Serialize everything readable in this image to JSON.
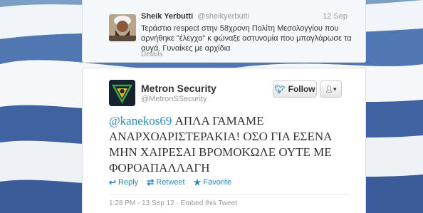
{
  "reply_tweet": {
    "name": "Sheik Yerbutti",
    "handle": "@sheikyerbutti",
    "time": "12 Sep",
    "text": "Τεράστιο respect στην 58χρονη Πολίτη Μεσολογγίου που αρνήθηκε \"έλεγχο\" κ φώναξε αστυνομία που μπαγλάρωσε τα αυγά. Γυναίκες με αρχίδια",
    "details_label": "Details"
  },
  "main_tweet": {
    "name": "Metron Security",
    "handle": "@MetronSSecurity",
    "follow_label": "Follow",
    "mention": "@kanekos69",
    "text": " ΑΠΛΑ ΓΑΜΑΜΕ ΑΝΑΡΧΟΑΡΙΣΤΕΡΑΚΙΑ! ΟΣΟ ΓΙΑ ΕΣΕΝΑ ΜΗΝ ΧΑΙΡΕΣΑΙ ΒΡΟΜΟΚΩΛΕ ΟΥΤΕ ΜΕ ΦΟΡΟΑΠΑΛΛΑΓΗ",
    "actions": {
      "reply": "Reply",
      "retweet": "Retweet",
      "favorite": "Favorite"
    },
    "meta": "1:28 PM - 13 Sep 12 · Embed this Tweet"
  },
  "colors": {
    "link": "#2a8ab8",
    "flag_blue": "#4a6fa8",
    "flag_white": "#ffffff"
  },
  "icons": {
    "follow": "bird-icon",
    "user_menu": "user-dropdown-icon",
    "reply": "reply-arrow-icon",
    "retweet": "retweet-icon",
    "favorite": "star-icon"
  }
}
